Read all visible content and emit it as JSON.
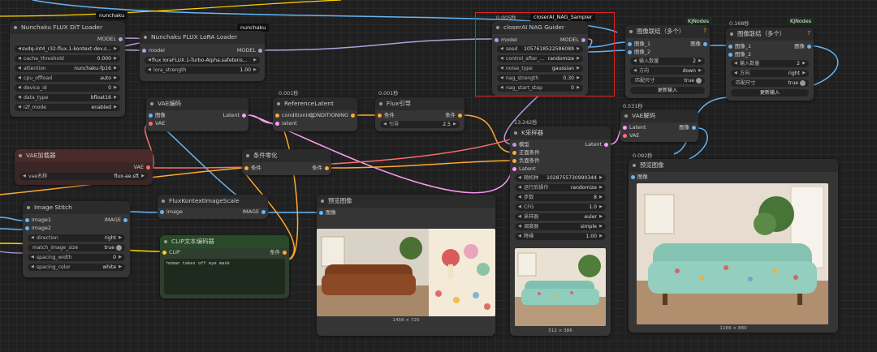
{
  "tags": {
    "nunchaku_dit": "nunchaku",
    "nunchaku_lora": "nunchaku",
    "nag_sampler": "closerAI_NAG_Sampler",
    "kj_1": "KJNodes",
    "kj_2": "KJNodes"
  },
  "timings": {
    "nag": "0.005秒",
    "reference": "0.001秒",
    "flux_guidance": "0.001秒",
    "ksampler": "13.242秒",
    "concat_2": "0.168秒",
    "vae_decode": "0.531秒",
    "preview_right": "0.092秒"
  },
  "dit_loader": {
    "title": "Nunchaku FLUX DiT Loader",
    "output": "MODEL",
    "widgets": [
      {
        "label": "",
        "value": "svdq-int4_r32-flux.1-kontext-dev.s..."
      },
      {
        "label": "cache_threshold",
        "value": "0.000"
      },
      {
        "label": "attention",
        "value": "nunchaku-fp16"
      },
      {
        "label": "cpu_offload",
        "value": "auto"
      },
      {
        "label": "device_id",
        "value": "0"
      },
      {
        "label": "data_type",
        "value": "bfloat16"
      },
      {
        "label": "i2f_mode",
        "value": "enabled"
      }
    ]
  },
  "lora_loader": {
    "title": "Nunchaku FLUX LoRA Loader",
    "input": "model",
    "output": "MODEL",
    "widgets": [
      {
        "label": "",
        "value": "flux loraFLUX.1-Turbo-Alpha.safetens..."
      },
      {
        "label": "lora_strength",
        "value": "1.00"
      }
    ]
  },
  "nag_guider": {
    "title": "closerAI NAG Guider",
    "input": "model",
    "output": "MODEL",
    "widgets": [
      {
        "label": "seed",
        "value": "1057618522586089"
      },
      {
        "label": "control_after_...",
        "value": "randomize"
      },
      {
        "label": "noise_type",
        "value": "gaussian"
      },
      {
        "label": "nag_strength",
        "value": "0.30"
      },
      {
        "label": "nag_start_step",
        "value": "0"
      }
    ]
  },
  "concat_1": {
    "title": "图像联结（多个）",
    "inputs": [
      "图像_1",
      "图像_2"
    ],
    "output": "图像",
    "widgets": [
      {
        "label": "输入数量",
        "value": "2"
      },
      {
        "label": "方向",
        "value": "down"
      },
      {
        "label": "匹配尺寸",
        "value": "true"
      }
    ],
    "button": "更新输入"
  },
  "concat_2": {
    "title": "图像联结（多个）",
    "inputs": [
      "图像_1",
      "图像_2"
    ],
    "output": "图像",
    "widgets": [
      {
        "label": "输入数量",
        "value": "2"
      },
      {
        "label": "方向",
        "value": "right"
      },
      {
        "label": "匹配尺寸",
        "value": "true"
      }
    ],
    "button": "更新输入"
  },
  "vae_encode": {
    "title": "VAE编码",
    "inputs": [
      "图像",
      "VAE"
    ],
    "output": "Latent"
  },
  "reference_latent": {
    "title": "ReferenceLatent",
    "inputs": [
      "conditioning",
      "latent"
    ],
    "output": "CONDITIONING"
  },
  "flux_guidance": {
    "title": "Flux引导",
    "input": "条件",
    "output": "条件",
    "widgets": [
      {
        "label": "引导",
        "value": "2.5"
      }
    ]
  },
  "ksampler": {
    "title": "K采样器",
    "inputs": [
      "模型",
      "正面条件",
      "负面条件",
      "Latent"
    ],
    "output": "Latent",
    "widgets": [
      {
        "label": "随机种",
        "value": "1028755730990344"
      },
      {
        "label": "运行后操作",
        "value": "randomize"
      },
      {
        "label": "步数",
        "value": "8"
      },
      {
        "label": "CFG",
        "value": "1.0"
      },
      {
        "label": "采样器",
        "value": "euler"
      },
      {
        "label": "调度器",
        "value": "simple"
      },
      {
        "label": "降噪",
        "value": "1.00"
      }
    ],
    "caption": "512 × 386"
  },
  "vae_loader": {
    "title": "VAE加载器",
    "output": "VAE",
    "widgets": [
      {
        "label": "vae名称",
        "value": "flux-ae.sft"
      }
    ]
  },
  "zero_out": {
    "title": "条件零化",
    "input": "条件",
    "output": "条件"
  },
  "vae_decode": {
    "title": "VAE解码",
    "inputs": [
      "Latent",
      "VAE"
    ],
    "output": "图像"
  },
  "image_stitch": {
    "title": "Image Stitch",
    "inputs": [
      "image1",
      "image2"
    ],
    "output": "IMAGE",
    "widgets": [
      {
        "label": "direction",
        "value": "right"
      },
      {
        "label": "match_image_size",
        "value": "true"
      },
      {
        "label": "spacing_width",
        "value": "0"
      },
      {
        "label": "spacing_color",
        "value": "white"
      }
    ]
  },
  "kontext_scale": {
    "title": "FluxKontextImageScale",
    "input": "image",
    "output": "IMAGE"
  },
  "clip_encode": {
    "title": "CLIP文本编码器",
    "input": "CLIP",
    "output": "条件",
    "text": "homan takes off eye mask"
  },
  "preview_mid": {
    "title": "预览图像",
    "input": "图像",
    "caption": "1456 × 720"
  },
  "preview_right": {
    "title": "预览图像",
    "input": "图像",
    "caption": "1166 × 880"
  },
  "colors": {
    "model_wire": "#b39ddb",
    "image_wire": "#64b5f6",
    "cond_wire": "#ffa931",
    "latent_wire": "#ff9cf9",
    "vae_wire": "#ff6e6e",
    "clip_wire": "#ffd500",
    "highlight": "#e02424"
  }
}
